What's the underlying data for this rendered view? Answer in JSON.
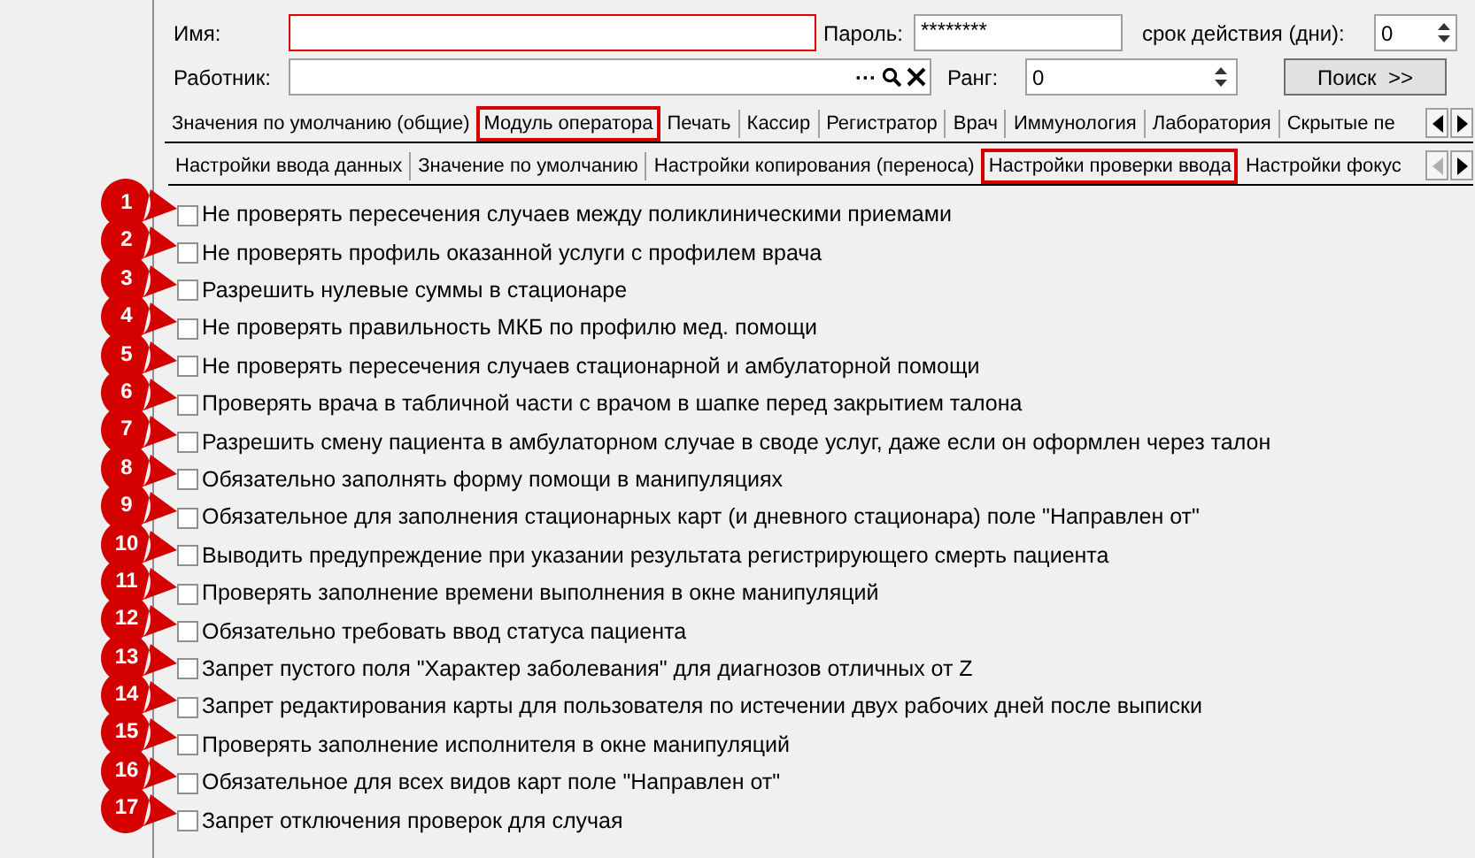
{
  "form": {
    "name_label": "Имя:",
    "password_label": "Пароль:",
    "password_value": "********",
    "validity_label": "срок действия (дни):",
    "validity_value": "0",
    "worker_label": "Работник:",
    "worker_buttons": [
      "···"
    ],
    "rank_label": "Ранг:",
    "rank_value": "0",
    "search_button": "Поиск  >>"
  },
  "tabs": [
    {
      "label": "Значения по умолчанию (общие)",
      "selected": false
    },
    {
      "label": "Модуль оператора",
      "selected": true
    },
    {
      "label": "Печать",
      "selected": false
    },
    {
      "label": "Кассир",
      "selected": false
    },
    {
      "label": "Регистратор",
      "selected": false
    },
    {
      "label": "Врач",
      "selected": false
    },
    {
      "label": "Иммунология",
      "selected": false
    },
    {
      "label": "Лаборатория",
      "selected": false
    },
    {
      "label": "Скрытые пе",
      "selected": false
    }
  ],
  "tab_scroll": [
    {
      "kind": "left",
      "disabled": false
    },
    {
      "kind": "right",
      "disabled": false
    }
  ],
  "subtabs": [
    {
      "label": "Настройки ввода данных",
      "selected": false
    },
    {
      "label": "Значение по умолчанию",
      "selected": false
    },
    {
      "label": "Настройки копирования (переноса)",
      "selected": false
    },
    {
      "label": "Настройки проверки ввода",
      "selected": true
    },
    {
      "label": "Настройки фокус",
      "selected": false
    }
  ],
  "subtab_scroll": [
    {
      "kind": "left",
      "disabled": true
    },
    {
      "kind": "right",
      "disabled": false
    }
  ],
  "options": [
    {
      "number": "1",
      "label": "Не проверять пересечения случаев между поликлиническими приемами",
      "checked": false
    },
    {
      "number": "2",
      "label": "Не проверять профиль оказанной услуги с профилем врача",
      "checked": false
    },
    {
      "number": "3",
      "label": "Разрешить нулевые суммы в стационаре",
      "checked": false
    },
    {
      "number": "4",
      "label": "Не проверять правильность МКБ по профилю мед. помощи",
      "checked": false
    },
    {
      "number": "5",
      "label": "Не проверять пересечения случаев стационарной и амбулаторной помощи",
      "checked": false
    },
    {
      "number": "6",
      "label": "Проверять врача в табличной части с врачом в шапке перед закрытием талона",
      "checked": false
    },
    {
      "number": "7",
      "label": "Разрешить смену пациента в амбулаторном случае в своде услуг, даже если он оформлен через талон",
      "checked": false
    },
    {
      "number": "8",
      "label": "Обязательно заполнять форму помощи в манипуляциях",
      "checked": false
    },
    {
      "number": "9",
      "label": "Обязательное для заполнения стационарных карт (и дневного стационара) поле \"Направлен от\"",
      "checked": false
    },
    {
      "number": "10",
      "label": "Выводить предупреждение при указании результата регистрирующего смерть пациента",
      "checked": false
    },
    {
      "number": "11",
      "label": "Проверять заполнение времени выполнения в окне манипуляций",
      "checked": false
    },
    {
      "number": "12",
      "label": "Обязательно требовать ввод статуса пациента",
      "checked": false
    },
    {
      "number": "13",
      "label": "Запрет пустого поля \"Характер заболевания\" для диагнозов отличных от Z",
      "checked": false
    },
    {
      "number": "14",
      "label": "Запрет редактирования карты для пользователя по истечении двух рабочих дней после выписки",
      "checked": false
    },
    {
      "number": "15",
      "label": "Проверять заполнение исполнителя в окне манипуляций",
      "checked": false
    },
    {
      "number": "16",
      "label": "Обязательное для всех видов карт поле \"Направлен от\"",
      "checked": false
    },
    {
      "number": "17",
      "label": "Запрет отключения проверок для случая",
      "checked": false
    }
  ]
}
